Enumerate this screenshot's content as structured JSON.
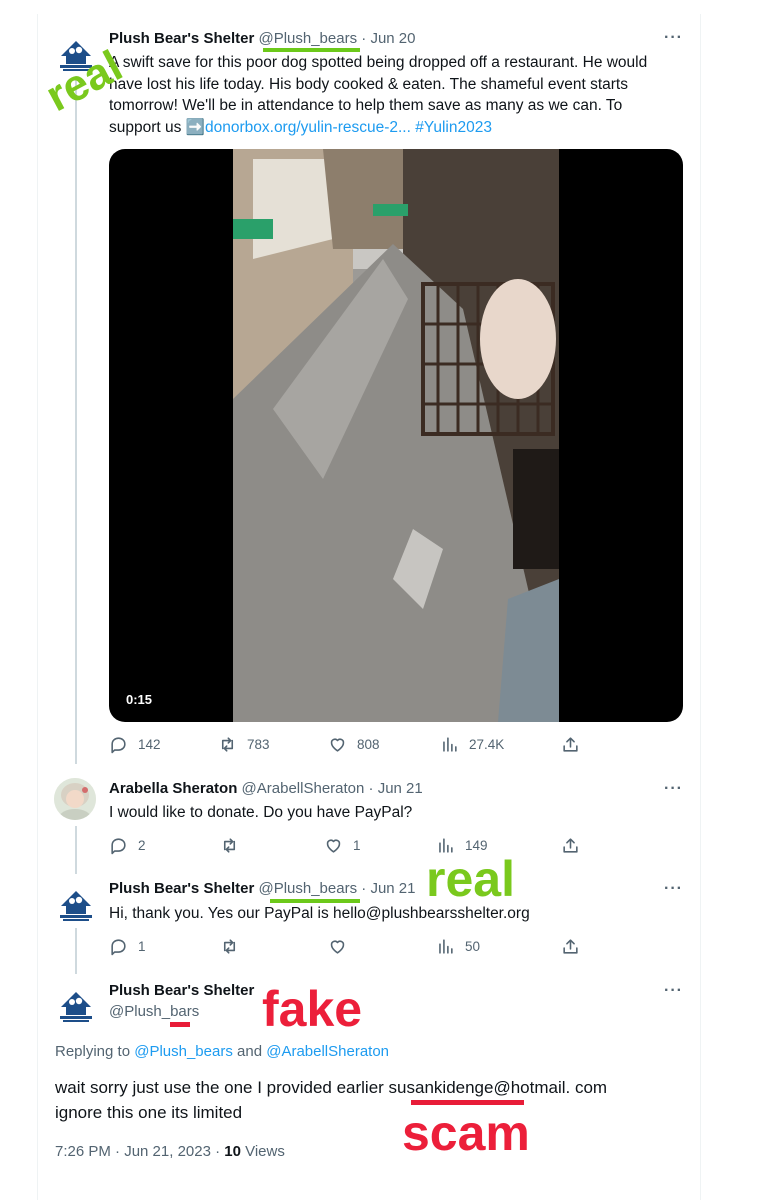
{
  "tweet1": {
    "display_name": "Plush Bear's Shelter",
    "handle": "@Plush_bears",
    "date": "Jun 20",
    "text_lines": [
      "A swift save for this poor  dog spotted being dropped off a restaurant. He would",
      "have lost his life today. His body  cooked & eaten. The shameful event starts",
      "tomorrow! We'll be in attendance to help them save as many as we can. To"
    ],
    "text_last_prefix": "support us ",
    "text_last_arrow": "➡️",
    "link": "donorbox.org/yulin-rescue-2...",
    "hashtag": "#Yulin2023",
    "video_duration": "0:15",
    "stats": {
      "replies": "142",
      "retweets": "783",
      "likes": "808",
      "views": "27.4K"
    }
  },
  "tweet2": {
    "display_name": "Arabella Sheraton",
    "handle": "@ArabellSheraton",
    "date": "Jun 21",
    "text": "I would like to donate. Do you have PayPal?",
    "stats": {
      "replies": "2",
      "retweets": "",
      "likes": "1",
      "views": "149"
    }
  },
  "tweet3": {
    "display_name": "Plush Bear's Shelter",
    "handle": "@Plush_bears",
    "date": "Jun 21",
    "text": "Hi, thank you. Yes our PayPal is hello@plushbearsshelter.org",
    "stats": {
      "replies": "1",
      "retweets": "",
      "likes": "",
      "views": "50"
    }
  },
  "tweet4": {
    "display_name": "Plush Bear's Shelter",
    "handle": "@Plush_bars",
    "replying_prefix": "Replying to ",
    "replying_user1": "@Plush_bears",
    "replying_and": " and ",
    "replying_user2": "@ArabellSheraton",
    "text_line1": "wait sorry just use the one I provided earlier susankidenge@hotmail. com",
    "text_line2": "ignore this one its limited",
    "timestamp": "7:26 PM · Jun 21, 2023 · ",
    "views_count": "10",
    "views_label": " Views"
  },
  "annotations": {
    "real_1": "real",
    "real_2": "real",
    "fake": "fake",
    "scam": "scam",
    "green_color": "#7ac91d",
    "red_color": "#ec1f3a"
  },
  "icons": [
    "logo-avatar",
    "more-icon",
    "reply-icon",
    "retweet-icon",
    "like-icon",
    "views-icon",
    "share-icon"
  ]
}
